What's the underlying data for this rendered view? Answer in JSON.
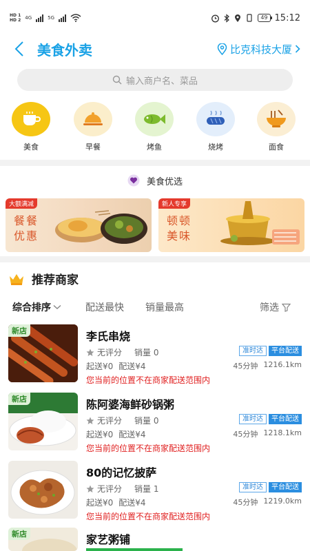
{
  "status_bar": {
    "hd1": "HD 1",
    "hd2": "HD 2",
    "net1": "4G",
    "net2": "5G",
    "battery": "49",
    "time": "15:12"
  },
  "header": {
    "title": "美食外卖",
    "location": "比克科技大厦"
  },
  "search": {
    "placeholder": "输入商户名、菜品"
  },
  "categories": [
    {
      "label": "美食",
      "icon": "coffee-cup-icon",
      "bg": "#f6c614"
    },
    {
      "label": "早餐",
      "icon": "food-cloche-icon",
      "bg": "#fbeecb"
    },
    {
      "label": "烤鱼",
      "icon": "fish-icon",
      "bg": "#e4f4d0"
    },
    {
      "label": "烧烤",
      "icon": "sausage-icon",
      "bg": "#e3eefb"
    },
    {
      "label": "面食",
      "icon": "noodle-bowl-icon",
      "bg": "#fbeed3"
    }
  ],
  "featured": {
    "title": "美食优选"
  },
  "banners": [
    {
      "tag": "大额满减",
      "text": "餐餐优惠"
    },
    {
      "tag": "新人专享",
      "text": "顿顿美味"
    }
  ],
  "recommend": {
    "title": "推荐商家"
  },
  "sort": {
    "comprehensive": "综合排序",
    "fastest": "配送最快",
    "top_sales": "销量最高",
    "filter": "筛选"
  },
  "stores": [
    {
      "badge": "新店",
      "name": "李氏串烧",
      "rating": "无评分",
      "sales": "销量 0",
      "min_order": "起送¥0",
      "delivery_fee": "配送¥4",
      "tag1": "准时达",
      "tag2": "平台配送",
      "time": "45分钟",
      "distance": "1216.1km",
      "warning": "您当前的位置不在商家配送范围内"
    },
    {
      "badge": "新店",
      "name": "陈阿婆海鲜砂锅粥",
      "rating": "无评分",
      "sales": "销量 0",
      "min_order": "起送¥0",
      "delivery_fee": "配送¥4",
      "tag1": "准时达",
      "tag2": "平台配送",
      "time": "45分钟",
      "distance": "1218.1km",
      "warning": "您当前的位置不在商家配送范围内"
    },
    {
      "badge": "",
      "name": "80的记忆披萨",
      "rating": "无评分",
      "sales": "销量 1",
      "min_order": "起送¥0",
      "delivery_fee": "配送¥4",
      "tag1": "准时达",
      "tag2": "平台配送",
      "time": "45分钟",
      "distance": "1219.0km",
      "warning": "您当前的位置不在商家配送范围内"
    },
    {
      "badge": "新店",
      "name": "家艺粥铺"
    }
  ],
  "colors": {
    "accent": "#1aa2e6",
    "warning": "#e02020",
    "new_badge": "#2f8a2a"
  }
}
